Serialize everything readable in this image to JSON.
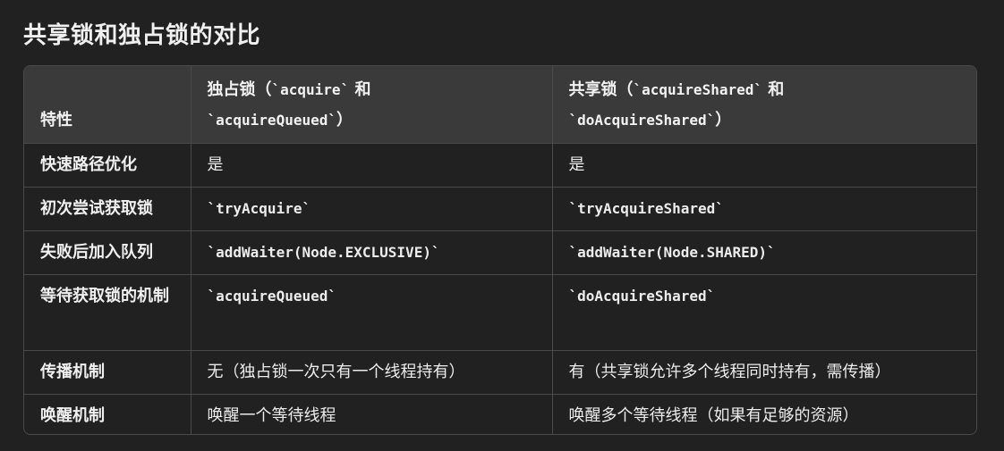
{
  "title": "共享锁和独占锁的对比",
  "table": {
    "headers": {
      "feature": "特性",
      "exclusive": {
        "label": "独占锁（",
        "code1": "`acquire`",
        "and": " 和",
        "code2": "`acquireQueued`",
        "close": "）"
      },
      "shared": {
        "label": "共享锁（",
        "code1": "`acquireShared`",
        "and": " 和",
        "code2": "`doAcquireShared`",
        "close": "）"
      }
    },
    "rows": [
      {
        "feature": "快速路径优化",
        "exclusive": "是",
        "shared": "是"
      },
      {
        "feature": "初次尝试获取锁",
        "exclusive": "`tryAcquire`",
        "shared": "`tryAcquireShared`"
      },
      {
        "feature": "失败后加入队列",
        "exclusive": "`addWaiter(Node.EXCLUSIVE)`",
        "shared": "`addWaiter(Node.SHARED)`"
      },
      {
        "feature": "等待获取锁的机制",
        "exclusive": "`acquireQueued`",
        "shared": "`doAcquireShared`"
      },
      {
        "feature": "传播机制",
        "exclusive": "无（独占锁一次只有一个线程持有）",
        "shared": "有（共享锁允许多个线程同时持有，需传播）"
      },
      {
        "feature": "唤醒机制",
        "exclusive": "唤醒一个等待线程",
        "shared": "唤醒多个等待线程（如果有足够的资源）"
      }
    ]
  }
}
